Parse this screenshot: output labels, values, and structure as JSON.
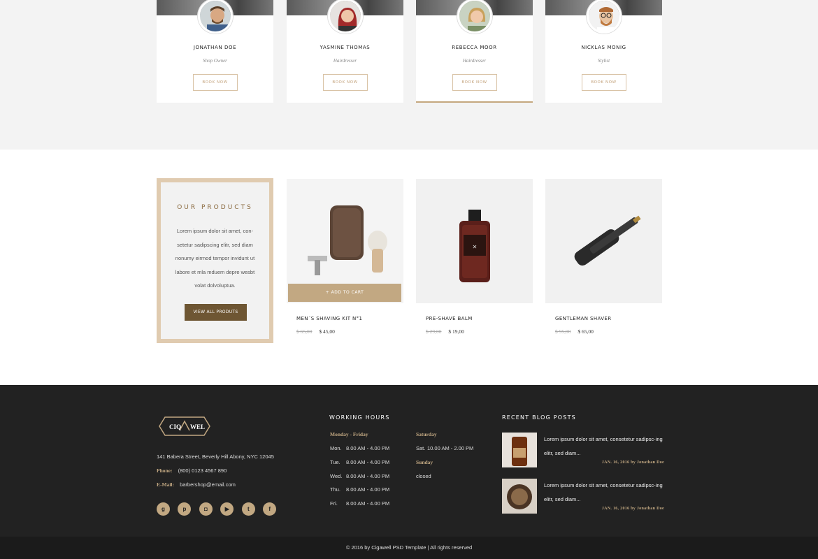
{
  "team": [
    {
      "name": "JONATHAN DOE",
      "role": "Shop Owner",
      "button": "BOOK NOW"
    },
    {
      "name": "YASMINE THOMAS",
      "role": "Hairdresser",
      "button": "BOOK NOW"
    },
    {
      "name": "REBECCA MOOR",
      "role": "Hairdresser",
      "button": "BOOK NOW"
    },
    {
      "name": "NICKLAS MONIG",
      "role": "Stylist",
      "button": "BOOK NOW"
    }
  ],
  "products_intro": {
    "title": "OUR PRODUCTS",
    "description": "Lorem ipsum dolor sit amet, con-setetur sadipscing elitr, sed diam nonumy eirmod tempor invidunt ut labore et mla mduem depre wesbt volat dolvoluptua.",
    "button": "VIEW ALL PRODUTS"
  },
  "products": [
    {
      "name": "MEN´S SHAVING KIT N°1",
      "old_price": "$ 65,00",
      "price": "$ 45,00",
      "add_to_cart": "+ ADD TO CART"
    },
    {
      "name": "PRE-SHAVE BALM",
      "old_price": "$ 29,00",
      "price": "$ 19,00"
    },
    {
      "name": "GENTLEMAN SHAVER",
      "old_price": "$ 95,00",
      "price": "$ 65,00"
    }
  ],
  "footer": {
    "logo_text_left": "CIQ",
    "logo_text_right": "WEL",
    "address": "141 Babera Street, Beverly Hill Abony, NYC 12045",
    "phone_label": "Phone:",
    "phone": "(800) 0123 4567 890",
    "email_label": "E-Mail:",
    "email": "barbershop@email.com",
    "socials": [
      "google-plus-icon",
      "pinterest-icon",
      "instagram-icon",
      "youtube-icon",
      "twitter-icon",
      "facebook-icon"
    ],
    "hours_heading": "WORKING HOURS",
    "weekday_label": "Monday - Friday",
    "weekdays": [
      {
        "day": "Mon.",
        "time": "8.00 AM - 4.00 PM"
      },
      {
        "day": "Tue.",
        "time": "8.00 AM - 4.00 PM"
      },
      {
        "day": "Wed.",
        "time": "8.00 AM - 4.00 PM"
      },
      {
        "day": "Thu.",
        "time": "8.00 AM - 4.00 PM"
      },
      {
        "day": "Fri.",
        "time": "8.00 AM - 4.00 PM"
      }
    ],
    "saturday_label": "Saturday",
    "saturday": {
      "day": "Sat.",
      "time": "10.00 AM - 2.00 PM"
    },
    "sunday_label": "Sunday",
    "sunday": "closed",
    "blog_heading": "RECENT BLOG POSTS",
    "blog_posts": [
      {
        "text": "Lorem ipsum dolor sit amet, consetetur sadipsc-ing elitr, sed diam...",
        "meta": "JAN. 16, 2016 by Jonathan Doe"
      },
      {
        "text": "Lorem ipsum dolor sit amet, consetetur sadipsc-ing elitr, sed diam...",
        "meta": "JAN. 16, 2016 by Jonathan Doe"
      }
    ],
    "copyright": "© 2016 by Cigawell PSD Template | All rights reserved"
  }
}
